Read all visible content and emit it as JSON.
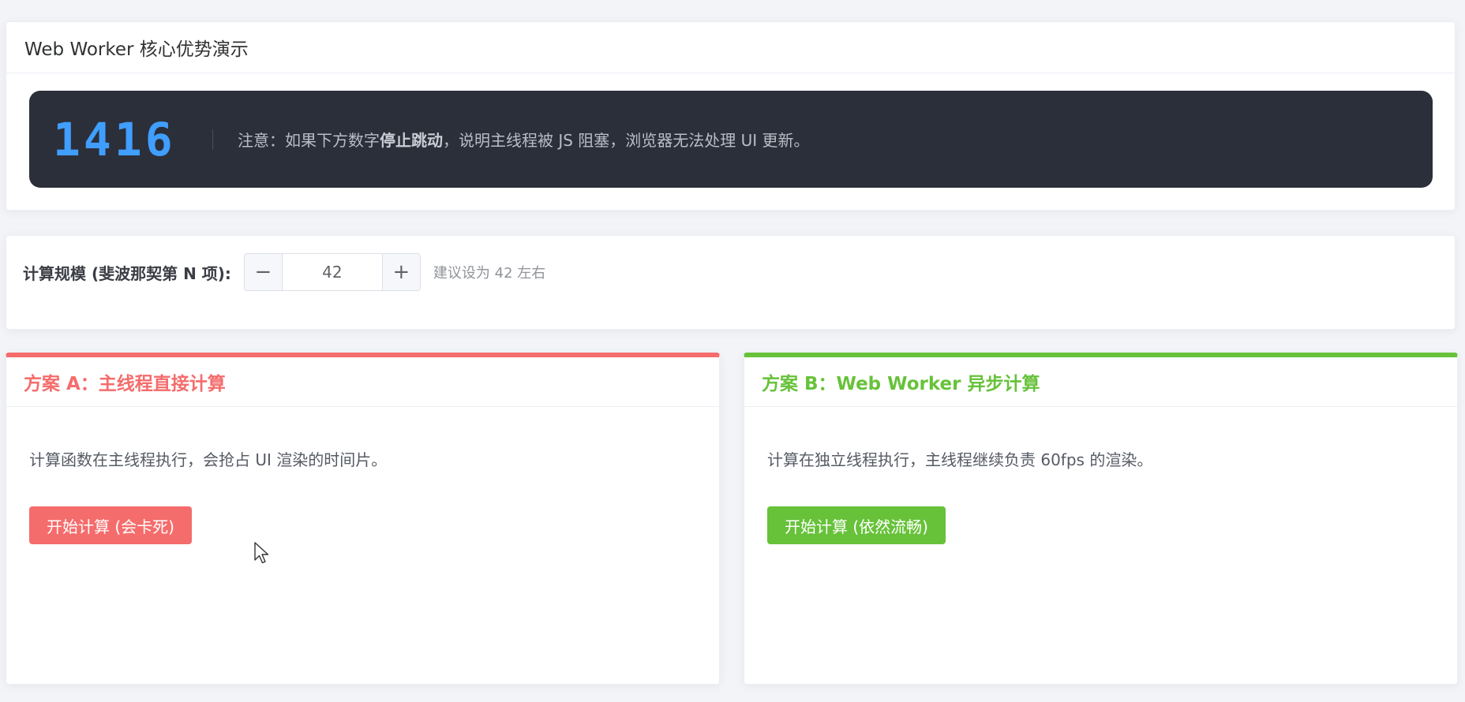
{
  "header": {
    "title": "Web Worker 核心优势演示"
  },
  "monitor": {
    "counter": "1416",
    "notice_prefix": "注意：如果下方数字",
    "notice_bold": "停止跳动",
    "notice_suffix": "，说明主线程被 JS 阻塞，浏览器无法处理 UI 更新。"
  },
  "scale": {
    "label": "计算规模 (斐波那契第 N 项):",
    "value": "42",
    "minus_symbol": "−",
    "plus_symbol": "+",
    "hint": "建议设为 42 左右"
  },
  "plan_a": {
    "title": "方案 A：主线程直接计算",
    "description": "计算函数在主线程执行，会抢占 UI 渲染的时间片。",
    "button_label": "开始计算 (会卡死)",
    "accent": "#f56c6c"
  },
  "plan_b": {
    "title": "方案 B：Web Worker 异步计算",
    "description": "计算在独立线程执行，主线程继续负责 60fps 的渲染。",
    "button_label": "开始计算 (依然流畅)",
    "accent": "#67c23a"
  },
  "icons": {
    "cursor": "mouse-pointer-icon"
  }
}
